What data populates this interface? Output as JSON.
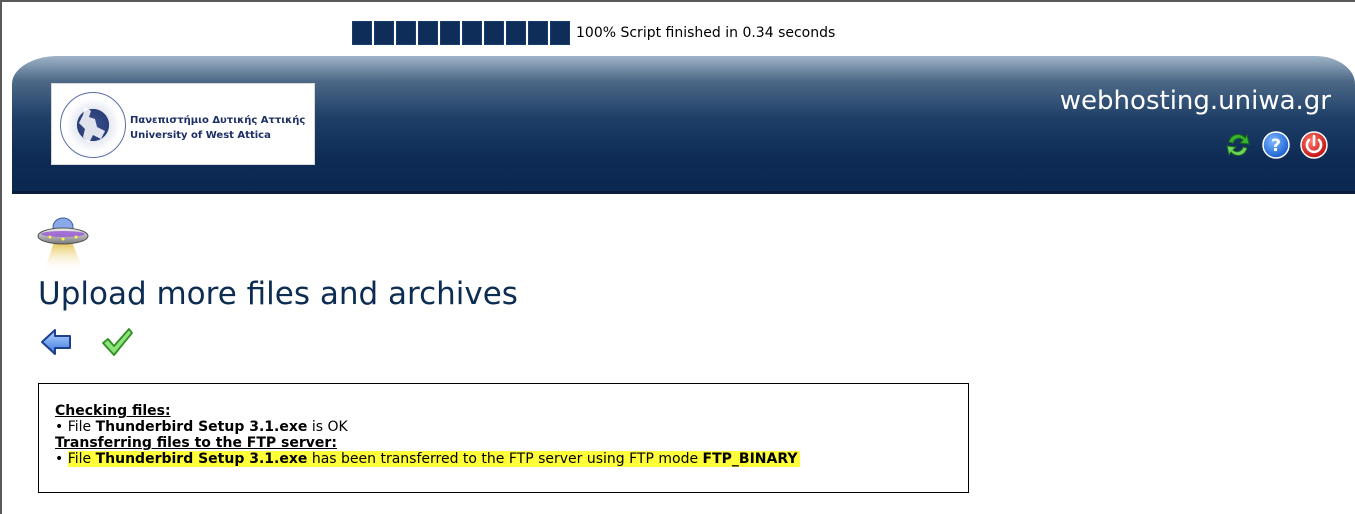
{
  "progress": {
    "percent": 100,
    "block_count": 10,
    "status_text": "100% Script finished in 0.34 seconds"
  },
  "header": {
    "logo_line_greek": "Πανεπιστήμιο Δυτικής Αττικής",
    "logo_line_english": "University of West Attica",
    "site_title": "webhosting.uniwa.gr",
    "icons": [
      "refresh-icon",
      "help-icon",
      "logout-icon"
    ]
  },
  "page": {
    "title": "Upload more files and archives",
    "icons": [
      "ufo-icon",
      "back-arrow-icon",
      "checkmark-icon"
    ]
  },
  "messages": {
    "checking_heading": "Checking files:",
    "check_bullet": "•",
    "check_prefix": "File ",
    "check_filename": "Thunderbird Setup 3.1.exe",
    "check_suffix": " is OK",
    "transfer_heading": "Transferring files to the FTP server:",
    "transfer_bullet": "•",
    "transfer_prefix": "File ",
    "transfer_filename": "Thunderbird Setup 3.1.exe",
    "transfer_middle": " has been transferred to the FTP server using FTP mode ",
    "transfer_mode": "FTP_BINARY"
  },
  "colors": {
    "header_dark": "#0a2750",
    "title_color": "#0c2c52",
    "highlight": "#ffff3a",
    "progress_block": "#0e2d58"
  }
}
